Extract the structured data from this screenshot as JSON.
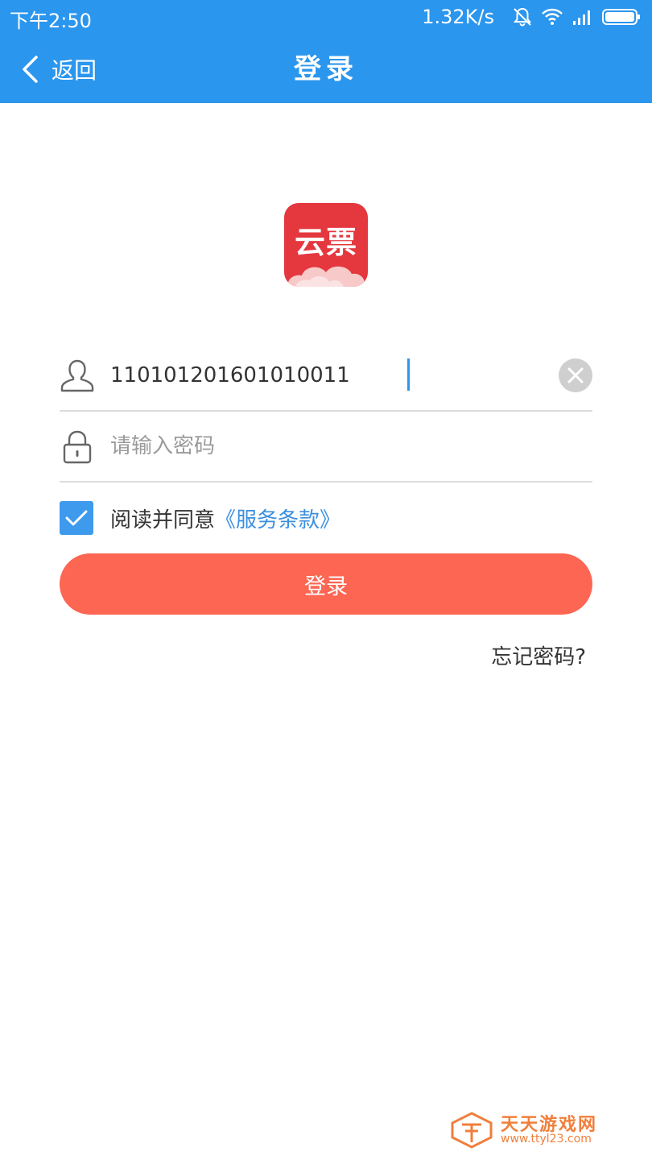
{
  "status_bar": {
    "time": "下午2:50",
    "net_speed": "1.32K/s",
    "icons": [
      "muted-bell-icon",
      "wifi-icon",
      "signal-icon",
      "battery-icon"
    ]
  },
  "nav": {
    "back_label": "返回",
    "title": "登录"
  },
  "logo": {
    "text": "云票"
  },
  "form": {
    "username_value": "110101201601010011",
    "password_placeholder": "请输入密码",
    "agree_checked": true,
    "agree_text": "阅读并同意",
    "terms_link": "《服务条款》",
    "login_button": "登录",
    "forgot_password": "忘记密码?"
  },
  "watermark": {
    "name": "天天游戏网",
    "url": "www.ttyl23.com"
  },
  "colors": {
    "primary": "#2b96ee",
    "login_button": "#fc6653",
    "logo_red": "#e4373e",
    "link": "#3b8fdf",
    "watermark": "#f07f3c"
  }
}
